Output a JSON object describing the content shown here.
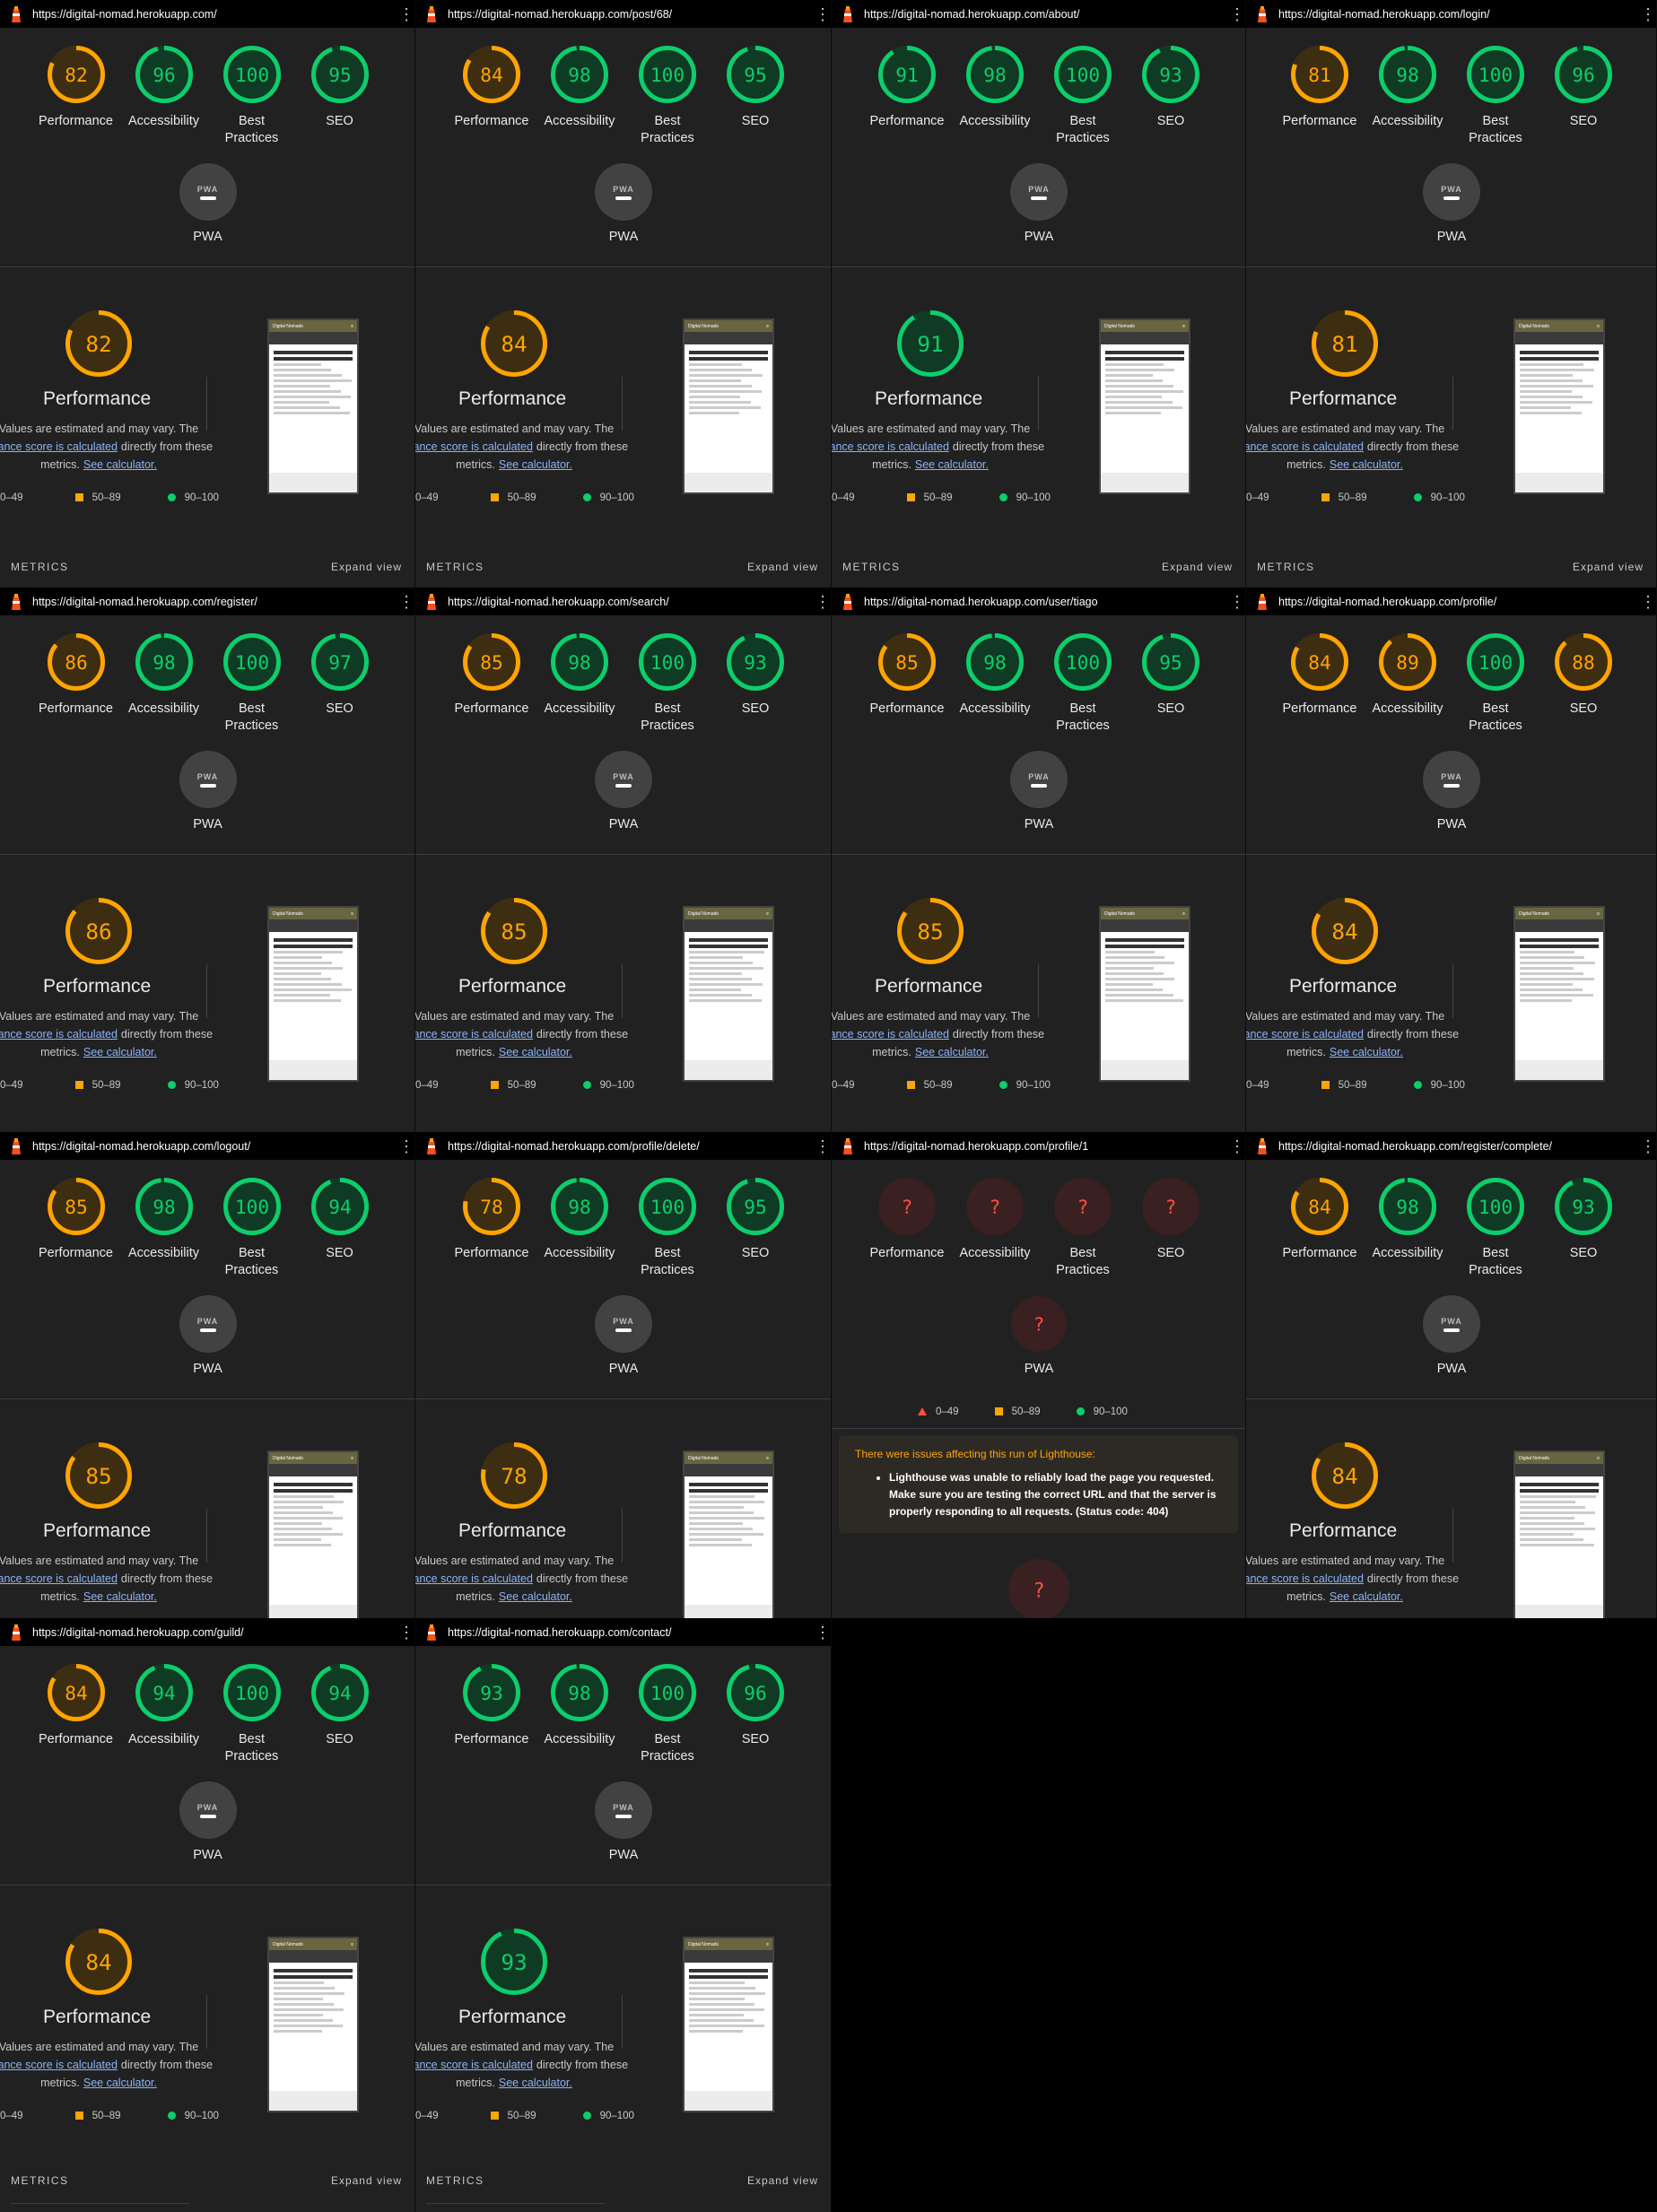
{
  "colors": {
    "pass": "#0cce6b",
    "average": "#ffa400",
    "fail": "#ff4e42",
    "bg": "#212121"
  },
  "labels": {
    "performance": "Performance",
    "accessibility": "Accessibility",
    "best1": "Best",
    "best2": "Practices",
    "seo": "SEO",
    "pwa": "PWA",
    "pwa_badge": "PWA",
    "perf_title": "Performance",
    "desc1": "Values are estimated and may vary. The",
    "desc_link": "rmance score is calculated",
    "desc2": "directly from these",
    "desc3": "metrics.",
    "calc_link": "See calculator.",
    "leg_fail": "0–49",
    "leg_avg": "50–89",
    "leg_pass": "90–100",
    "metrics": "METRICS",
    "expand": "Expand view",
    "unknown": "?"
  },
  "thumb_brand": "Digital Nomads",
  "warning": {
    "title": "There were issues affecting this run of Lighthouse:",
    "message": "Lighthouse was unable to reliably load the page you requested. Make sure you are testing the correct URL and that the server is properly responding to all requests. (Status code: 404)"
  },
  "reports": [
    {
      "url": "https://digital-nomad.herokuapp.com/",
      "scores": {
        "performance": 82,
        "accessibility": 96,
        "best_practices": 100,
        "seo": 95
      }
    },
    {
      "url": "https://digital-nomad.herokuapp.com/post/68/",
      "scores": {
        "performance": 84,
        "accessibility": 98,
        "best_practices": 100,
        "seo": 95
      }
    },
    {
      "url": "https://digital-nomad.herokuapp.com/about/",
      "scores": {
        "performance": 91,
        "accessibility": 98,
        "best_practices": 100,
        "seo": 93
      }
    },
    {
      "url": "https://digital-nomad.herokuapp.com/login/",
      "scores": {
        "performance": 81,
        "accessibility": 98,
        "best_practices": 100,
        "seo": 96
      }
    },
    {
      "url": "https://digital-nomad.herokuapp.com/register/",
      "scores": {
        "performance": 86,
        "accessibility": 98,
        "best_practices": 100,
        "seo": 97
      }
    },
    {
      "url": "https://digital-nomad.herokuapp.com/search/",
      "scores": {
        "performance": 85,
        "accessibility": 98,
        "best_practices": 100,
        "seo": 93
      }
    },
    {
      "url": "https://digital-nomad.herokuapp.com/user/tiago",
      "scores": {
        "performance": 85,
        "accessibility": 98,
        "best_practices": 100,
        "seo": 95
      }
    },
    {
      "url": "https://digital-nomad.herokuapp.com/profile/",
      "scores": {
        "performance": 84,
        "accessibility": 89,
        "best_practices": 100,
        "seo": 88
      }
    },
    {
      "url": "https://digital-nomad.herokuapp.com/logout/",
      "scores": {
        "performance": 85,
        "accessibility": 98,
        "best_practices": 100,
        "seo": 94
      }
    },
    {
      "url": "https://digital-nomad.herokuapp.com/profile/delete/",
      "scores": {
        "performance": 78,
        "accessibility": 98,
        "best_practices": 100,
        "seo": 95
      }
    },
    {
      "url": "https://digital-nomad.herokuapp.com/profile/1",
      "scores": {
        "performance": null,
        "accessibility": null,
        "best_practices": null,
        "seo": null
      },
      "error": true
    },
    {
      "url": "https://digital-nomad.herokuapp.com/register/complete/",
      "scores": {
        "performance": 84,
        "accessibility": 98,
        "best_practices": 100,
        "seo": 93
      }
    },
    {
      "url": "https://digital-nomad.herokuapp.com/guild/",
      "scores": {
        "performance": 84,
        "accessibility": 94,
        "best_practices": 100,
        "seo": 94
      }
    },
    {
      "url": "https://digital-nomad.herokuapp.com/contact/",
      "scores": {
        "performance": 93,
        "accessibility": 98,
        "best_practices": 100,
        "seo": 96
      }
    }
  ]
}
